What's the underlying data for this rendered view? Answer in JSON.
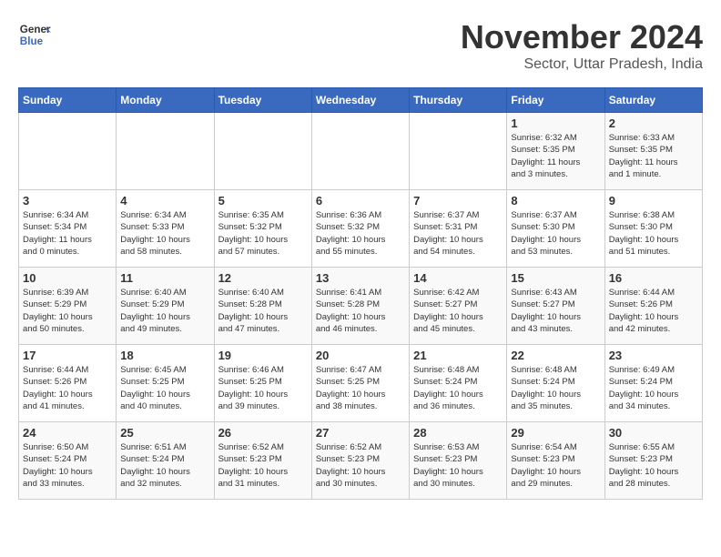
{
  "logo": {
    "name": "GeneralBlue",
    "line1": "General",
    "line2": "Blue"
  },
  "header": {
    "month": "November 2024",
    "location": "Sector, Uttar Pradesh, India"
  },
  "weekdays": [
    "Sunday",
    "Monday",
    "Tuesday",
    "Wednesday",
    "Thursday",
    "Friday",
    "Saturday"
  ],
  "weeks": [
    [
      {
        "day": "",
        "info": ""
      },
      {
        "day": "",
        "info": ""
      },
      {
        "day": "",
        "info": ""
      },
      {
        "day": "",
        "info": ""
      },
      {
        "day": "",
        "info": ""
      },
      {
        "day": "1",
        "info": "Sunrise: 6:32 AM\nSunset: 5:35 PM\nDaylight: 11 hours\nand 3 minutes."
      },
      {
        "day": "2",
        "info": "Sunrise: 6:33 AM\nSunset: 5:35 PM\nDaylight: 11 hours\nand 1 minute."
      }
    ],
    [
      {
        "day": "3",
        "info": "Sunrise: 6:34 AM\nSunset: 5:34 PM\nDaylight: 11 hours\nand 0 minutes."
      },
      {
        "day": "4",
        "info": "Sunrise: 6:34 AM\nSunset: 5:33 PM\nDaylight: 10 hours\nand 58 minutes."
      },
      {
        "day": "5",
        "info": "Sunrise: 6:35 AM\nSunset: 5:32 PM\nDaylight: 10 hours\nand 57 minutes."
      },
      {
        "day": "6",
        "info": "Sunrise: 6:36 AM\nSunset: 5:32 PM\nDaylight: 10 hours\nand 55 minutes."
      },
      {
        "day": "7",
        "info": "Sunrise: 6:37 AM\nSunset: 5:31 PM\nDaylight: 10 hours\nand 54 minutes."
      },
      {
        "day": "8",
        "info": "Sunrise: 6:37 AM\nSunset: 5:30 PM\nDaylight: 10 hours\nand 53 minutes."
      },
      {
        "day": "9",
        "info": "Sunrise: 6:38 AM\nSunset: 5:30 PM\nDaylight: 10 hours\nand 51 minutes."
      }
    ],
    [
      {
        "day": "10",
        "info": "Sunrise: 6:39 AM\nSunset: 5:29 PM\nDaylight: 10 hours\nand 50 minutes."
      },
      {
        "day": "11",
        "info": "Sunrise: 6:40 AM\nSunset: 5:29 PM\nDaylight: 10 hours\nand 49 minutes."
      },
      {
        "day": "12",
        "info": "Sunrise: 6:40 AM\nSunset: 5:28 PM\nDaylight: 10 hours\nand 47 minutes."
      },
      {
        "day": "13",
        "info": "Sunrise: 6:41 AM\nSunset: 5:28 PM\nDaylight: 10 hours\nand 46 minutes."
      },
      {
        "day": "14",
        "info": "Sunrise: 6:42 AM\nSunset: 5:27 PM\nDaylight: 10 hours\nand 45 minutes."
      },
      {
        "day": "15",
        "info": "Sunrise: 6:43 AM\nSunset: 5:27 PM\nDaylight: 10 hours\nand 43 minutes."
      },
      {
        "day": "16",
        "info": "Sunrise: 6:44 AM\nSunset: 5:26 PM\nDaylight: 10 hours\nand 42 minutes."
      }
    ],
    [
      {
        "day": "17",
        "info": "Sunrise: 6:44 AM\nSunset: 5:26 PM\nDaylight: 10 hours\nand 41 minutes."
      },
      {
        "day": "18",
        "info": "Sunrise: 6:45 AM\nSunset: 5:25 PM\nDaylight: 10 hours\nand 40 minutes."
      },
      {
        "day": "19",
        "info": "Sunrise: 6:46 AM\nSunset: 5:25 PM\nDaylight: 10 hours\nand 39 minutes."
      },
      {
        "day": "20",
        "info": "Sunrise: 6:47 AM\nSunset: 5:25 PM\nDaylight: 10 hours\nand 38 minutes."
      },
      {
        "day": "21",
        "info": "Sunrise: 6:48 AM\nSunset: 5:24 PM\nDaylight: 10 hours\nand 36 minutes."
      },
      {
        "day": "22",
        "info": "Sunrise: 6:48 AM\nSunset: 5:24 PM\nDaylight: 10 hours\nand 35 minutes."
      },
      {
        "day": "23",
        "info": "Sunrise: 6:49 AM\nSunset: 5:24 PM\nDaylight: 10 hours\nand 34 minutes."
      }
    ],
    [
      {
        "day": "24",
        "info": "Sunrise: 6:50 AM\nSunset: 5:24 PM\nDaylight: 10 hours\nand 33 minutes."
      },
      {
        "day": "25",
        "info": "Sunrise: 6:51 AM\nSunset: 5:24 PM\nDaylight: 10 hours\nand 32 minutes."
      },
      {
        "day": "26",
        "info": "Sunrise: 6:52 AM\nSunset: 5:23 PM\nDaylight: 10 hours\nand 31 minutes."
      },
      {
        "day": "27",
        "info": "Sunrise: 6:52 AM\nSunset: 5:23 PM\nDaylight: 10 hours\nand 30 minutes."
      },
      {
        "day": "28",
        "info": "Sunrise: 6:53 AM\nSunset: 5:23 PM\nDaylight: 10 hours\nand 30 minutes."
      },
      {
        "day": "29",
        "info": "Sunrise: 6:54 AM\nSunset: 5:23 PM\nDaylight: 10 hours\nand 29 minutes."
      },
      {
        "day": "30",
        "info": "Sunrise: 6:55 AM\nSunset: 5:23 PM\nDaylight: 10 hours\nand 28 minutes."
      }
    ]
  ]
}
